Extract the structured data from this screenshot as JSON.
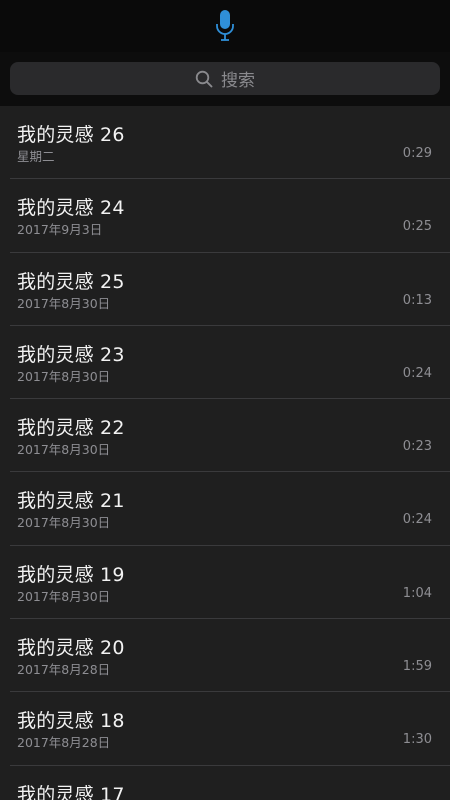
{
  "header": {
    "icon": "microphone-icon",
    "accent_color": "#2f8fd8"
  },
  "search": {
    "placeholder": "搜索",
    "icon": "search-icon"
  },
  "recordings": [
    {
      "title": "我的灵感 26",
      "date": "星期二",
      "duration": "0:29"
    },
    {
      "title": "我的灵感 24",
      "date": "2017年9月3日",
      "duration": "0:25"
    },
    {
      "title": "我的灵感 25",
      "date": "2017年8月30日",
      "duration": "0:13"
    },
    {
      "title": "我的灵感 23",
      "date": "2017年8月30日",
      "duration": "0:24"
    },
    {
      "title": "我的灵感 22",
      "date": "2017年8月30日",
      "duration": "0:23"
    },
    {
      "title": "我的灵感 21",
      "date": "2017年8月30日",
      "duration": "0:24"
    },
    {
      "title": "我的灵感 19",
      "date": "2017年8月30日",
      "duration": "1:04"
    },
    {
      "title": "我的灵感 20",
      "date": "2017年8月28日",
      "duration": "1:59"
    },
    {
      "title": "我的灵感 18",
      "date": "2017年8月28日",
      "duration": "1:30"
    },
    {
      "title": "我的灵感 17",
      "date": "",
      "duration": ""
    }
  ]
}
